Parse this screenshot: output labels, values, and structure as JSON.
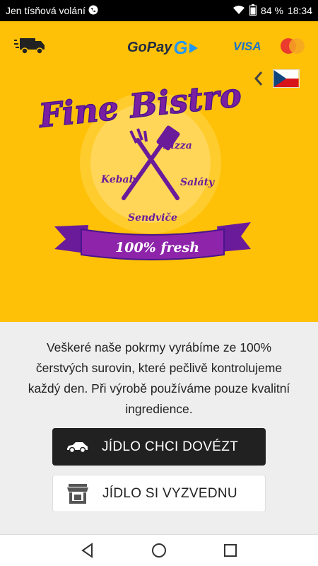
{
  "status_bar": {
    "carrier": "Jen tísňová volání",
    "battery": "84 %",
    "time": "18:34"
  },
  "header": {
    "gopay_text": "GoPay",
    "gopay_mark": "G",
    "visa_text": "VISA"
  },
  "logo": {
    "title": "Fine Bistro",
    "items": [
      "Pizza",
      "Kebab",
      "Saláty",
      "Sendviče"
    ],
    "ribbon": "100% fresh"
  },
  "panel": {
    "description": "Veškeré naše pokrmy vyrábíme ze 100% čerstvých surovin, které pečlivě kontrolujeme každý den. Při výrobě používáme pouze kvalitní ingredience.",
    "deliver_label": "JÍDLO CHCI DOVÉZT",
    "pickup_label": "JÍDLO SI VYZVEDNU"
  },
  "colors": {
    "accent": "#FFC107",
    "purple": "#6a1b9a",
    "dark_button": "#212121"
  }
}
